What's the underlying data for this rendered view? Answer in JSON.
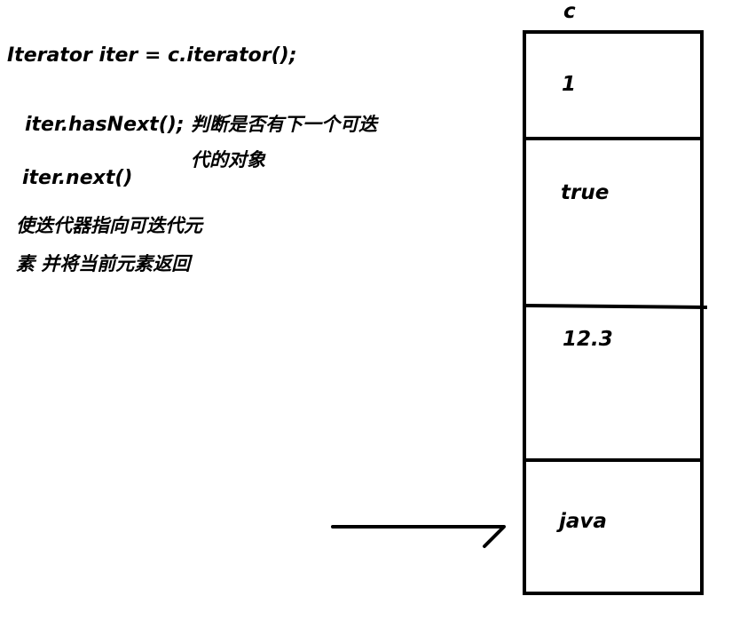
{
  "code": {
    "line1": "Iterator iter = c.iterator();",
    "line2": "iter.hasNext();",
    "line3": "iter.next()"
  },
  "notes": {
    "has_next_1": "判断是否有下一个可迭",
    "has_next_2": "代的对象",
    "next_1": "使迭代器指向可迭代元",
    "next_2": "素  并将当前元素返回"
  },
  "collection": {
    "label": "c",
    "items": [
      "1",
      "true",
      "12.3",
      "java"
    ]
  }
}
